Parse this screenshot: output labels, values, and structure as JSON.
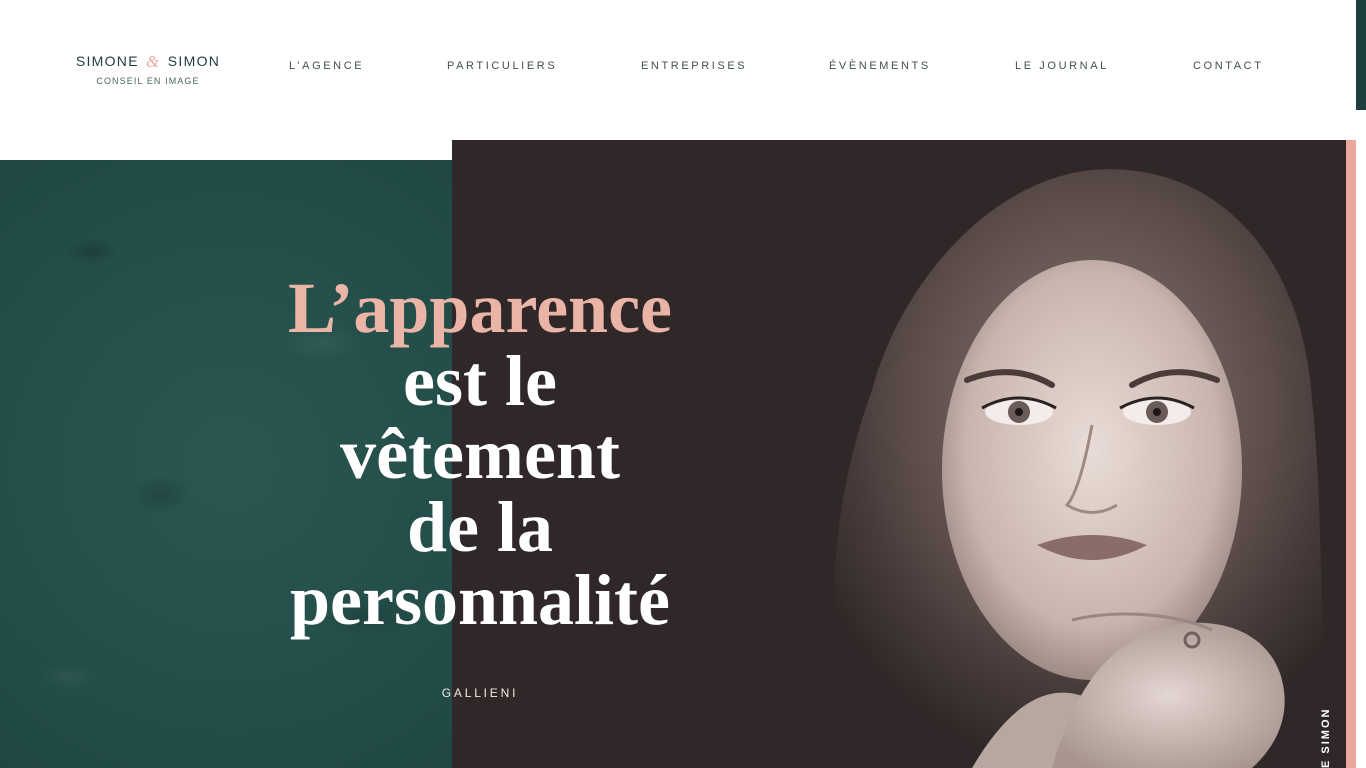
{
  "header": {
    "logo": {
      "name_part1": "SIMONE",
      "ampersand": "&",
      "name_part2": "SIMON",
      "tagline": "CONSEIL EN IMAGE"
    },
    "nav": [
      {
        "label": "L’AGENCE"
      },
      {
        "label": "PARTICULIERS"
      },
      {
        "label": "ENTREPRISES"
      },
      {
        "label": "ÉVÈNEMENTS"
      },
      {
        "label": "LE JOURNAL"
      },
      {
        "label": "CONTACT"
      }
    ]
  },
  "hero": {
    "quote": {
      "line1": "L’apparence",
      "line2": "est le",
      "line3": "vêtement",
      "line4": "de la",
      "line5": "personnalité"
    },
    "author": "GALLIENI",
    "vertical_caption": "E SIMON",
    "photo_icon": "portrait-photo"
  },
  "colors": {
    "accent_pink": "#eab4a6",
    "brand_green": "#23504b",
    "photo_dark": "#302828",
    "edge_pink": "#eba79a",
    "nav_text": "#41504d"
  }
}
